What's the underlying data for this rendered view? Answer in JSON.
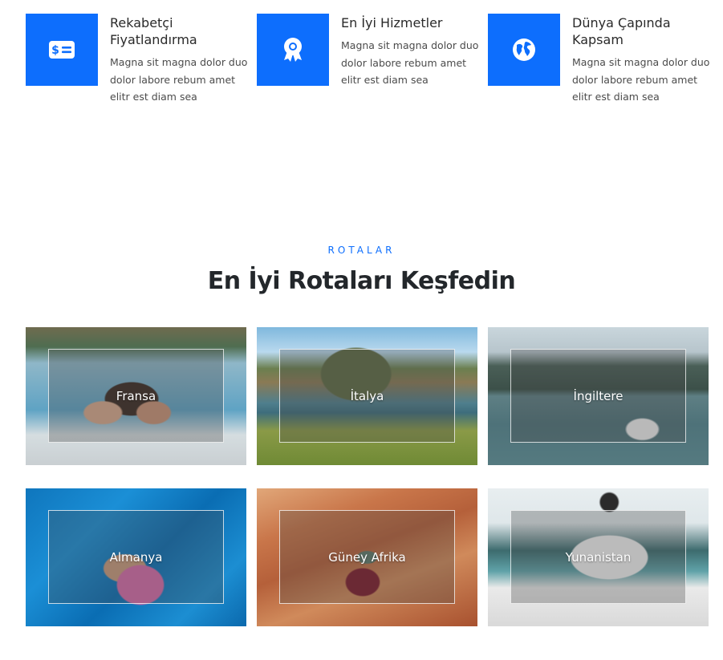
{
  "features": [
    {
      "icon": "money-bill-icon",
      "title": "Rekabetçi Fiyatlandırma",
      "text": "Magna sit magna dolor duo dolor labore rebum amet elitr est diam sea"
    },
    {
      "icon": "award-icon",
      "title": "En İyi Hizmetler",
      "text": "Magna sit magna dolor duo dolor labore rebum amet elitr est diam sea"
    },
    {
      "icon": "globe-icon",
      "title": "Dünya Çapında Kapsam",
      "text": "Magna sit magna dolor duo dolor labore rebum amet elitr est diam sea"
    }
  ],
  "destinations_section": {
    "eyebrow": "ROTALAR",
    "title": "En İyi Rotaları Keşfedin"
  },
  "destinations": [
    {
      "label": "Fransa"
    },
    {
      "label": "İtalya"
    },
    {
      "label": "İngiltere"
    },
    {
      "label": "Almanya"
    },
    {
      "label": "Güney Afrika"
    },
    {
      "label": "Yunanistan"
    }
  ],
  "colors": {
    "accent": "#0d6efd",
    "heading": "#23272b"
  }
}
